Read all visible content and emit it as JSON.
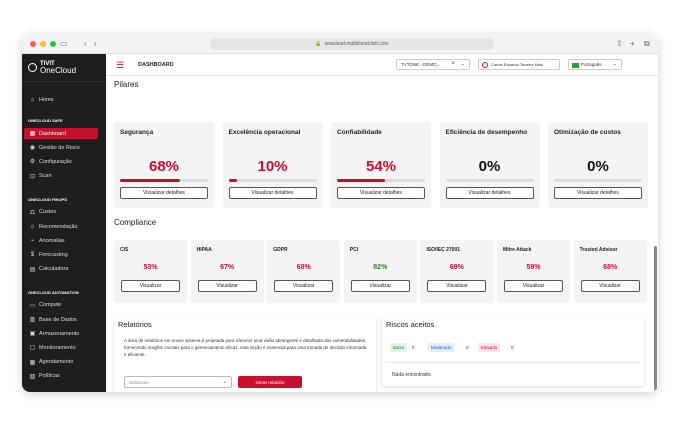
{
  "browser": {
    "url": "onecloud.multicloud.tivit.com",
    "dot_colors": [
      "#ff5f57",
      "#febc2e",
      "#28c840"
    ]
  },
  "sidebar": {
    "logo_line1": "TIVIT",
    "logo_line2": "OneCloud",
    "home": "Home",
    "sections": [
      {
        "title": "ONECLOUD SAFE",
        "items": [
          {
            "label": "Dashboard",
            "icon": "dashboard-icon",
            "glyph": "▦",
            "active": true
          },
          {
            "label": "Gestão de Risco",
            "icon": "risk-icon",
            "glyph": "◉"
          },
          {
            "label": "Configuração",
            "icon": "gear-icon",
            "glyph": "⚙"
          },
          {
            "label": "Scan",
            "icon": "scan-icon",
            "glyph": "⊡"
          }
        ]
      },
      {
        "title": "ONECLOUD FINOPS",
        "items": [
          {
            "label": "Custos",
            "icon": "costs-icon",
            "glyph": "⚖"
          },
          {
            "label": "Recomendação",
            "icon": "lightbulb-icon",
            "glyph": "☼"
          },
          {
            "label": "Anomalias",
            "icon": "anomaly-icon",
            "glyph": "⌁"
          },
          {
            "label": "Forecasting",
            "icon": "dollar-icon",
            "glyph": "$"
          },
          {
            "label": "Calculadora",
            "icon": "calculator-icon",
            "glyph": "▤"
          }
        ]
      },
      {
        "title": "ONECLOUD AUTOMATION",
        "items": [
          {
            "label": "Compute",
            "icon": "compute-icon",
            "glyph": "▭"
          },
          {
            "label": "Base de Dados",
            "icon": "database-icon",
            "glyph": "▥"
          },
          {
            "label": "Armazenamento",
            "icon": "storage-icon",
            "glyph": "▣"
          },
          {
            "label": "Monitoramento",
            "icon": "monitor-icon",
            "glyph": "▢"
          },
          {
            "label": "Agendamento",
            "icon": "calendar-icon",
            "glyph": "▦"
          },
          {
            "label": "Políticas",
            "icon": "policy-icon",
            "glyph": "▧"
          }
        ]
      }
    ]
  },
  "header": {
    "title": "DASHBOARD",
    "tenant": "TVTONE - DEMO...",
    "user": "Carlos Eduardo Teixeira Mais",
    "language": "Português"
  },
  "pilares": {
    "title": "Pilares",
    "button_label": "Visualizar detalhes",
    "items": [
      {
        "name": "Segurança",
        "percent": "68%",
        "value": 68,
        "color": "#c8102e"
      },
      {
        "name": "Excelência operacional",
        "percent": "10%",
        "value": 10,
        "color": "#c8102e"
      },
      {
        "name": "Confiabilidade",
        "percent": "54%",
        "value": 54,
        "color": "#c8102e"
      },
      {
        "name": "Eficiência de desempenho",
        "percent": "0%",
        "value": 0,
        "color": "#111111"
      },
      {
        "name": "Otimização de custos",
        "percent": "0%",
        "value": 0,
        "color": "#111111"
      }
    ]
  },
  "compliance": {
    "title": "Compliance",
    "button_label": "Visualizar",
    "items": [
      {
        "name": "CIS",
        "percent": "53%",
        "color": "#c8102e"
      },
      {
        "name": "HIPAA",
        "percent": "67%",
        "color": "#c8102e"
      },
      {
        "name": "GDPR",
        "percent": "68%",
        "color": "#c8102e"
      },
      {
        "name": "PCI",
        "percent": "82%",
        "color": "#2e7d32"
      },
      {
        "name": "ISO/IEC 27001",
        "percent": "69%",
        "color": "#c8102e"
      },
      {
        "name": "Mitre Attack",
        "percent": "59%",
        "color": "#c8102e"
      },
      {
        "name": "Trusted Advisor",
        "percent": "68%",
        "color": "#c8102e"
      }
    ]
  },
  "relatorios": {
    "title": "Relatórios",
    "description": "A área de relatórios em nosso sistema é projetada para oferecer uma visão abrangente e detalhada das vulnerabilidades, fornecendo insights cruciais para o gerenciamento eficaz. esta seção é essencial para uma tomada de decisão informada e eficiente.",
    "select_placeholder": "Selecione",
    "generate_label": "Gerar relatório"
  },
  "riscos": {
    "title": "Riscos aceitos",
    "badges": [
      {
        "label": "Baixo",
        "count": "0",
        "bg": "#e3f4e6",
        "fg": "#2e7d32"
      },
      {
        "label": "Moderado",
        "count": "0",
        "bg": "#e3eefc",
        "fg": "#1565c0"
      },
      {
        "label": "Elevado",
        "count": "0",
        "bg": "#fde6e6",
        "fg": "#c8102e"
      }
    ],
    "empty": "Nada encontrado."
  }
}
